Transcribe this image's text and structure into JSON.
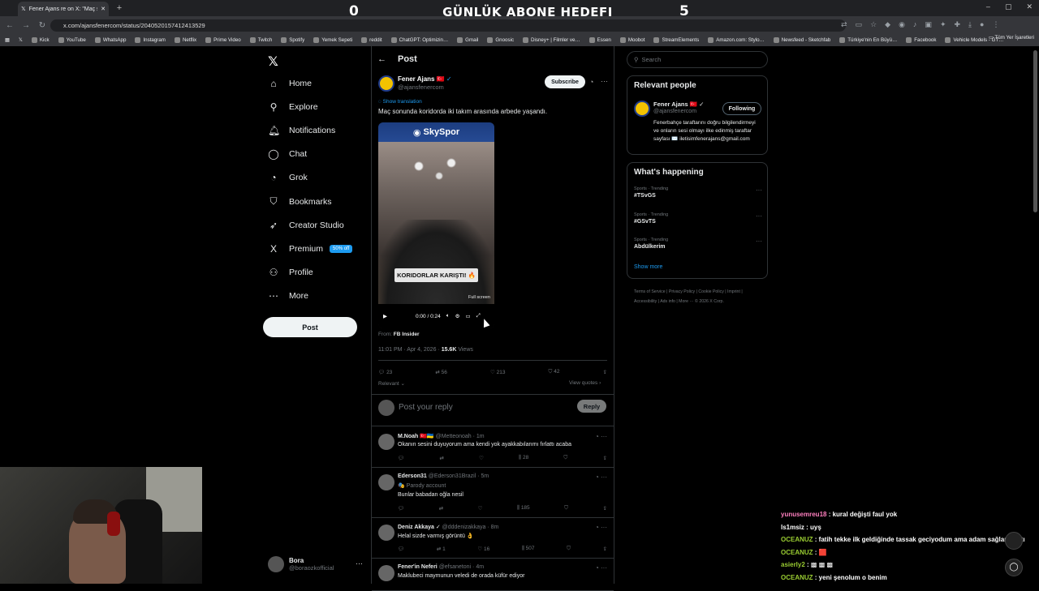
{
  "browser": {
    "tab_title": "Fener Ajans re on X: \"Maç sonu…",
    "url": "x.com/ajansfenercom/status/2040520157412413529",
    "bookmarks": [
      "Kick",
      "YouTube",
      "WhatsApp",
      "Instagram",
      "Netflix",
      "Prime Video",
      "Twitch",
      "Spotify",
      "Yemek Sepeti",
      "reddit",
      "ChatGPT: Optimizin…",
      "Gmail",
      "Gnoosic",
      "Disney+ | Filmler ve…",
      "Essen",
      "Moobot",
      "StreamElements",
      "Amazon.com: Stylo…",
      "Newsfeed - Sketchfab",
      "Türkiye'nin En Büyü…",
      "Facebook",
      "Vehicle Models - GT…"
    ],
    "bookmarks_right": "Tüm Yer İşaretleri"
  },
  "overlay": {
    "left_num": "0",
    "title": "GÜNLÜK ABONE HEDEFI",
    "right_num": "5"
  },
  "sidebar": {
    "items": [
      {
        "label": "Home",
        "icon": "home-icon",
        "glyph": "⌂"
      },
      {
        "label": "Explore",
        "icon": "search-icon",
        "glyph": "⚲"
      },
      {
        "label": "Notifications",
        "icon": "bell-icon",
        "glyph": "🔔︎"
      },
      {
        "label": "Chat",
        "icon": "chat-icon",
        "glyph": "◯"
      },
      {
        "label": "Grok",
        "icon": "grok-icon",
        "glyph": "◔"
      },
      {
        "label": "Bookmarks",
        "icon": "bookmark-icon",
        "glyph": "⛉"
      },
      {
        "label": "Creator Studio",
        "icon": "rocket-icon",
        "glyph": "➶"
      },
      {
        "label": "Premium",
        "icon": "x-icon",
        "glyph": "X"
      },
      {
        "label": "Profile",
        "icon": "person-icon",
        "glyph": "⚇"
      },
      {
        "label": "More",
        "icon": "more-icon",
        "glyph": "⋯"
      }
    ],
    "premium_badge": "50% off",
    "post_button": "Post",
    "account_name": "Bora",
    "account_handle": "@boraozkofficial"
  },
  "post": {
    "header": "Post",
    "author_name": "Fener Ajans 🇹🇷",
    "author_handle": "@ajansfenercom",
    "subscribe": "Subscribe",
    "show_translation": "Show translation",
    "text": "Maç sonunda koridorda iki takım arasında arbede yaşandı.",
    "video_brand": "SkySpor",
    "video_caption": "KORIDORLAR KARIŞTI! 🔥",
    "video_fullscreen": "Full screen",
    "video_time": "0:00 / 0:24",
    "from_label": "From",
    "from_source": "FB Insider",
    "timestamp": "11:01 PM · Apr 4, 2026 · ",
    "views_count": "15.6K",
    "views_label": " Views",
    "stats": {
      "replies": "23",
      "reposts": "56",
      "likes": "213",
      "bookmarks": "42"
    },
    "relevant": "Relevant ⌄",
    "view_quotes": "View quotes ›",
    "reply_placeholder": "Post your reply",
    "reply_button": "Reply"
  },
  "replies": [
    {
      "name": "M.Noah 🇹🇷🇺🇦",
      "meta": "@Metteonoah · 1m",
      "text": "Okanın sesini duyuyorum ama kendi yok ayakkabılarımı fırlattı acaba",
      "sub": "",
      "views": "28",
      "reposts": "",
      "likes": ""
    },
    {
      "name": "Ederson31",
      "meta": "@Ederson31Brazil · 5m",
      "text": "Bunlar babadan oğla nesil",
      "sub": "🎭 Parody account",
      "views": "185",
      "reposts": "",
      "likes": ""
    },
    {
      "name": "Deniz Akkaya ✓",
      "meta": "@dddenizakkaya · 8m",
      "text": "Helal sizde varmış görüntü 👌",
      "sub": "",
      "views": "507",
      "reposts": "1",
      "likes": "16"
    },
    {
      "name": "Fener'in Neferi",
      "meta": "@efsanetoni · 4m",
      "text": "Maklubeci maymunun veledi de orada küfür ediyor",
      "sub": "",
      "views": "",
      "reposts": "",
      "likes": ""
    }
  ],
  "right": {
    "search_placeholder": "Search",
    "relevant_title": "Relevant people",
    "rel_name": "Fener Ajans 🇹🇷 ✓",
    "rel_handle": "@ajansfenercom",
    "following": "Following",
    "rel_bio": "Fenerbahçe taraftarını doğru bilgilendirmeyi ve onların sesi olmayı ilke edinmiş taraftar sayfası ✉️ iletisimfenerajans@gmail.com",
    "whats_happening": "What's happening",
    "trends": [
      {
        "category": "Sports · Trending",
        "name": "#TSvGS"
      },
      {
        "category": "Sports · Trending",
        "name": "#GSvTS"
      },
      {
        "category": "Sports · Trending",
        "name": "Abdülkerim"
      }
    ],
    "show_more": "Show more",
    "footer": "Terms of Service  |  Privacy Policy  |  Cookie Policy  |  Imprint  |  Accessibility  |  Ads info  |  More ···  © 2026 X Corp."
  },
  "chat": [
    {
      "user": "yunusemreu18",
      "color": "#ff7fbf",
      "msg": " : kural değişti faul yok"
    },
    {
      "user": "ls1msiz",
      "color": "#ffffff",
      "msg": " : uyş"
    },
    {
      "user": "OCEANUZ",
      "color": "#9acd32",
      "msg": " : fatih tekke ilk geldiğinde tassak geciyodum ama adam sağlam çıktı"
    },
    {
      "user": "OCEANUZ",
      "color": "#9acd32",
      "msg": " : 🟥"
    },
    {
      "user": "asierly2",
      "color": "#9acd32",
      "msg": " : ▩ ▩ ▩"
    },
    {
      "user": "OCEANUZ",
      "color": "#9acd32",
      "msg": " : yeni şenolum o benim"
    }
  ]
}
